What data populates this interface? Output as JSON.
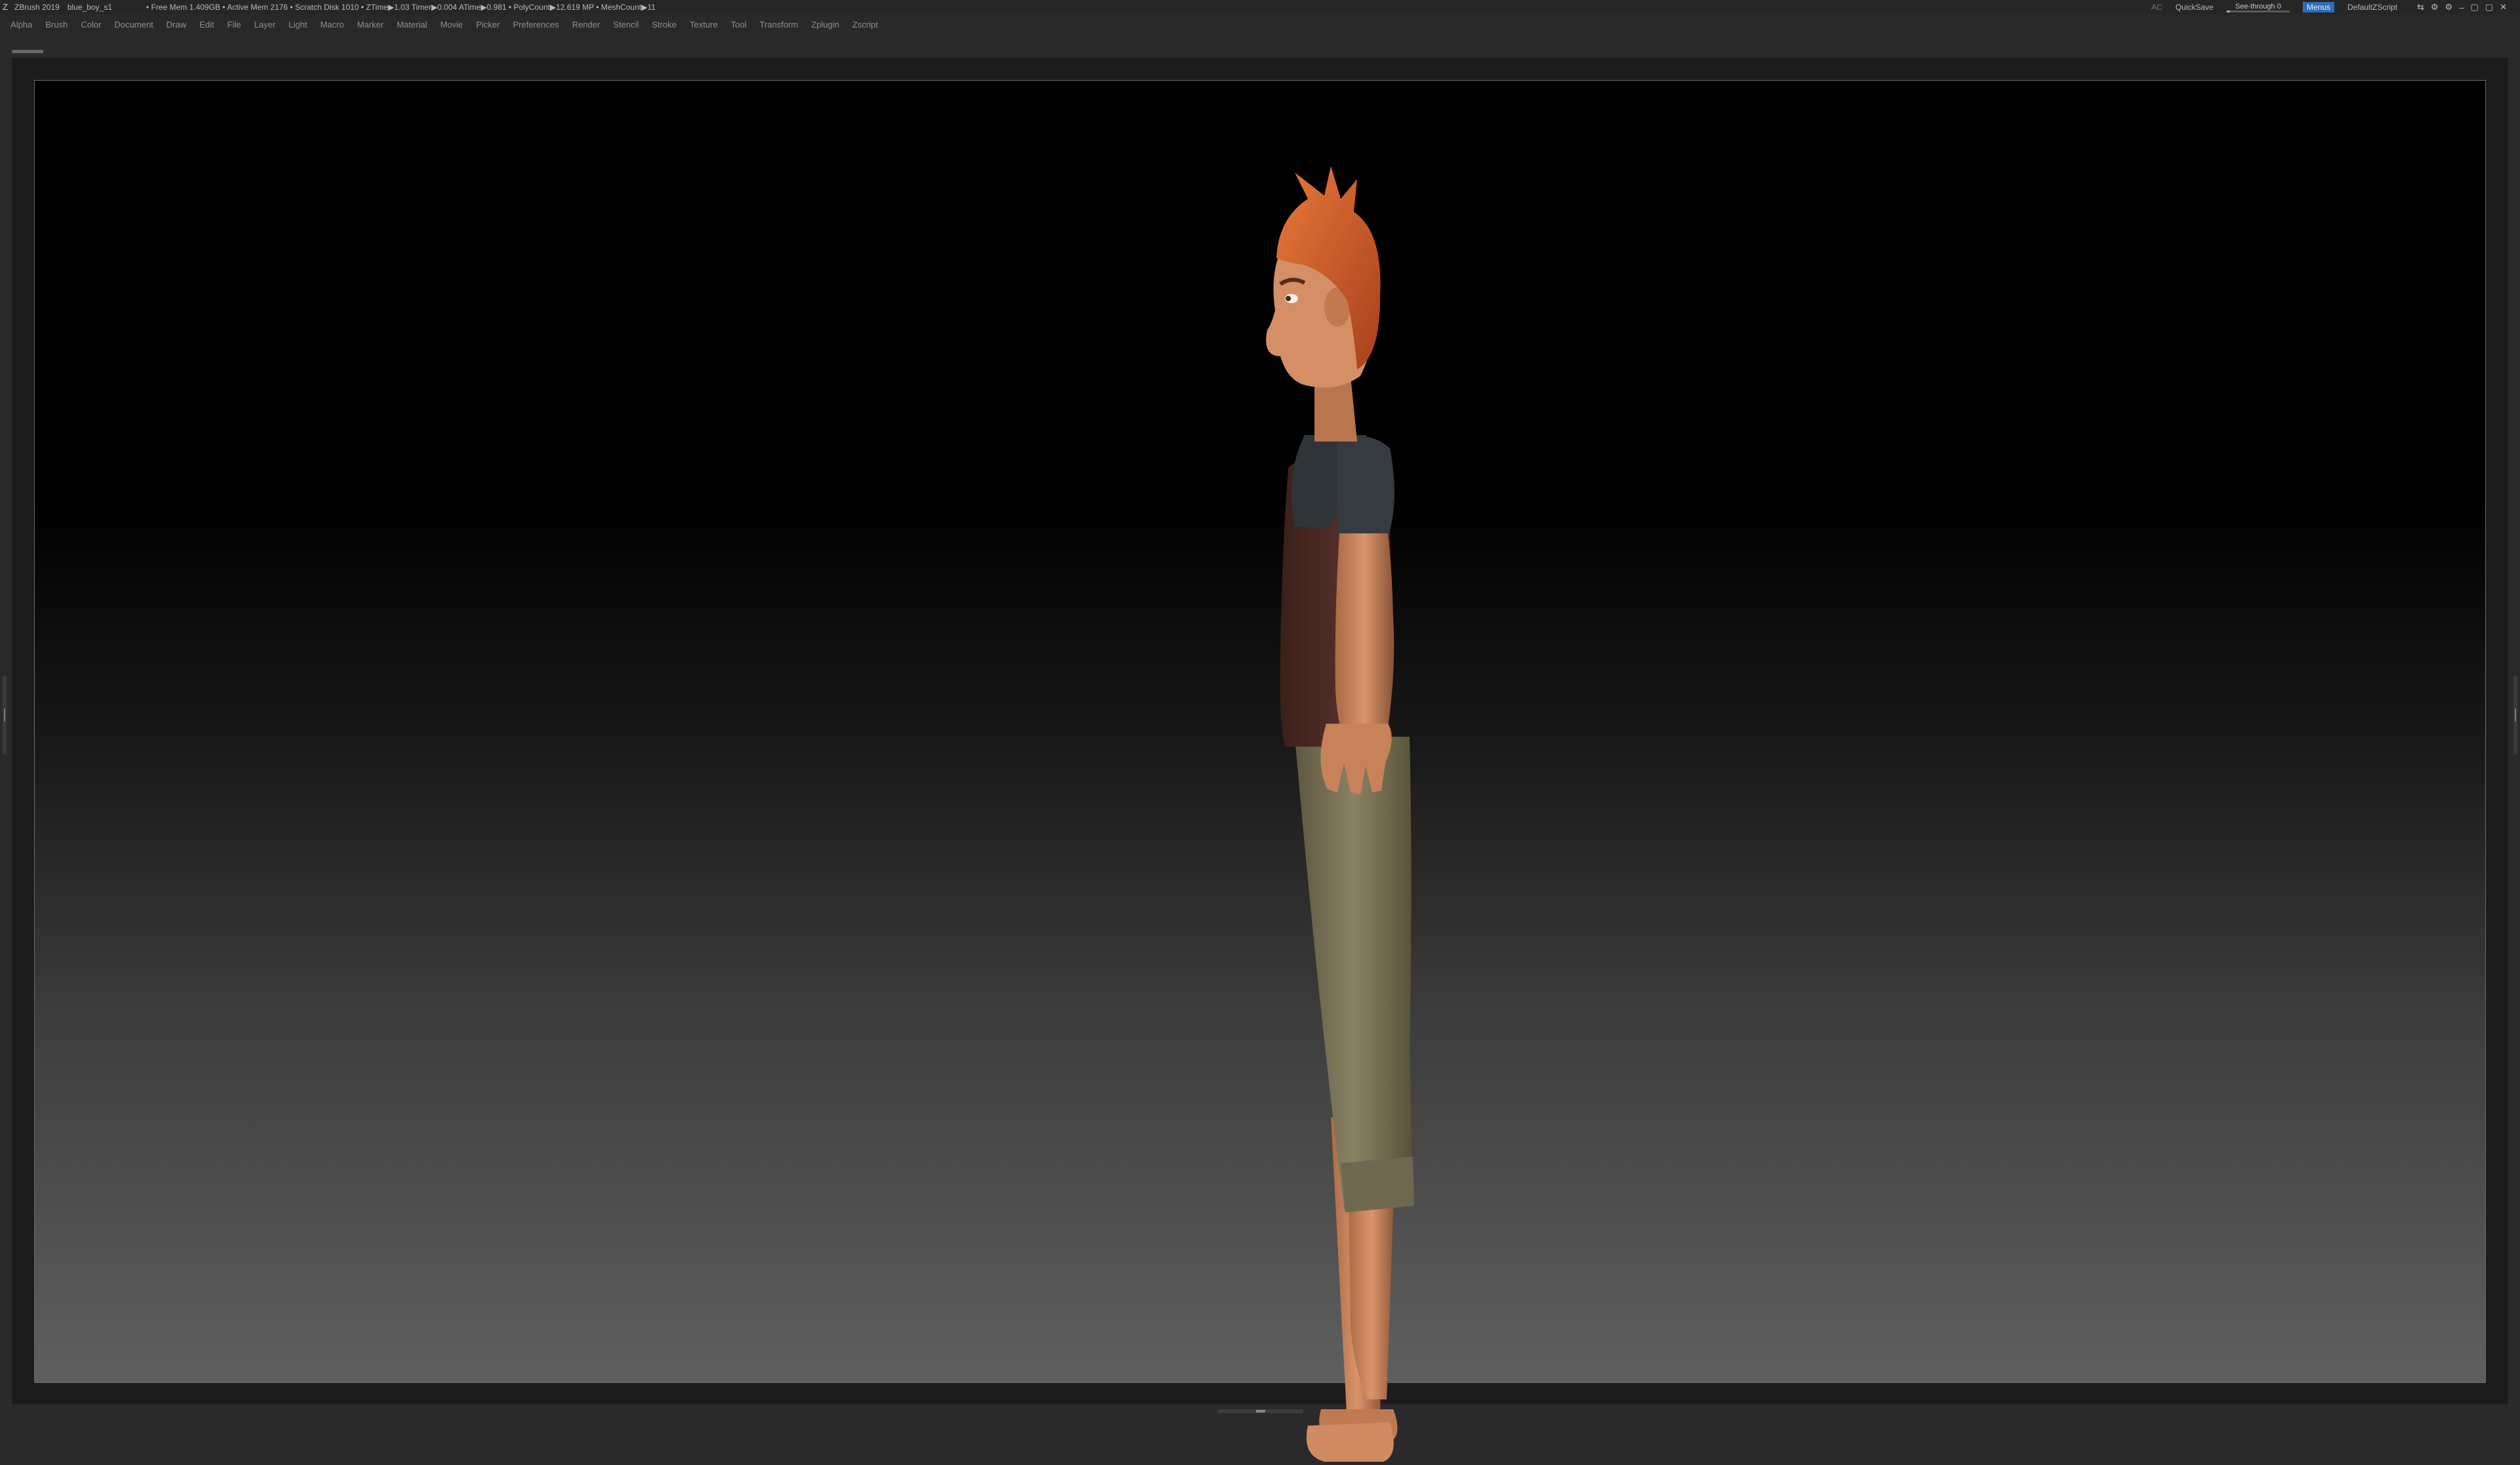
{
  "titlebar": {
    "app": "ZBrush 2019",
    "project": "blue_boy_s1",
    "stats": "• Free Mem 1.409GB • Active Mem 2176 • Scratch Disk 1010 • ZTime▶1.03 Timer▶0.004 ATime▶0.981 • PolyCount▶12.619 MP • MeshCount▶11",
    "ac": "AC",
    "quicksave": "QuickSave",
    "see_through_label": "See-through 0",
    "see_through_value": 0.05,
    "menus": "Menus",
    "script": "DefaultZScript"
  },
  "menubar": {
    "items": [
      "Alpha",
      "Brush",
      "Color",
      "Document",
      "Draw",
      "Edit",
      "File",
      "Layer",
      "Light",
      "Macro",
      "Marker",
      "Material",
      "Movie",
      "Picker",
      "Preferences",
      "Render",
      "Stencil",
      "Stroke",
      "Texture",
      "Tool",
      "Transform",
      "Zplugin",
      "Zscript"
    ]
  },
  "colors": {
    "skin": "#c8835a",
    "hair": "#d7602a",
    "vest": "#4a2a22",
    "shirt": "#2f3439",
    "pants": "#7b7358",
    "accent": "#2d6fb8"
  },
  "icons": [
    "zbrush-logo-icon",
    "window-controls-icon"
  ]
}
